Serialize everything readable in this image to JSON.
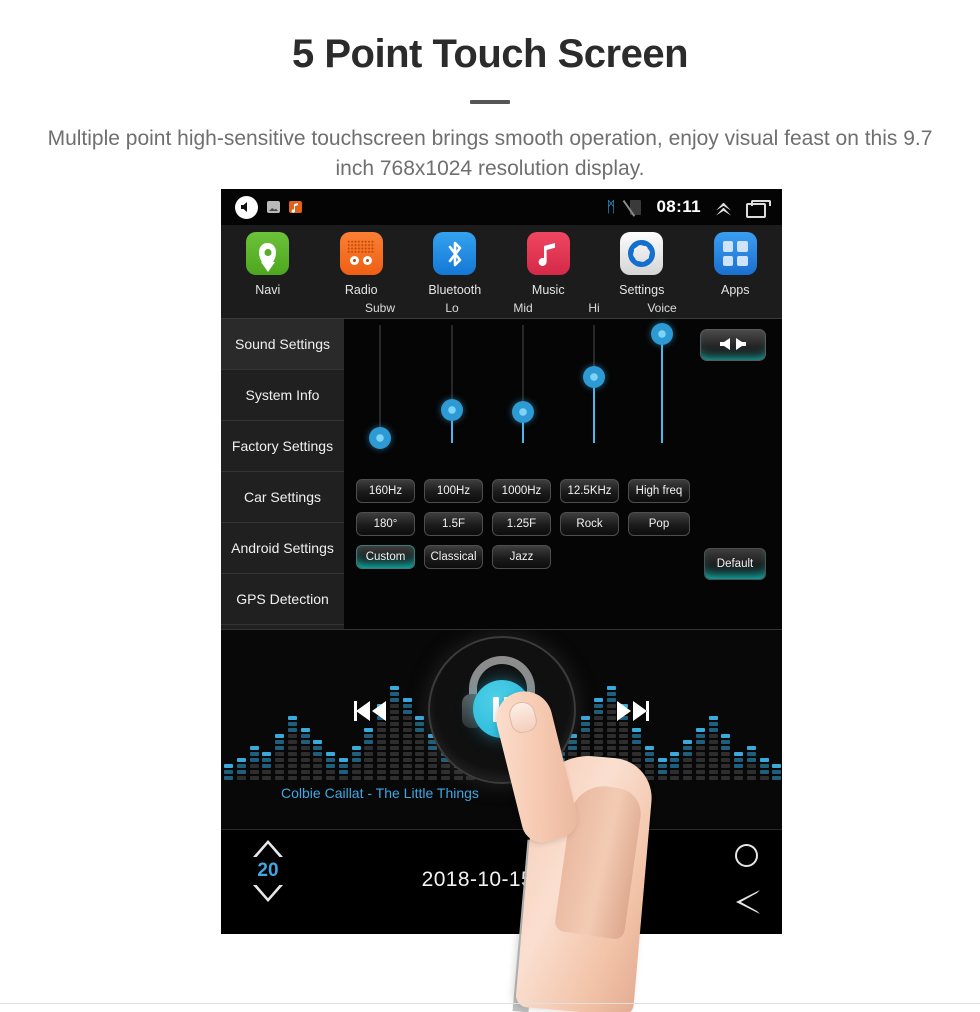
{
  "promo": {
    "title": "5 Point Touch Screen",
    "subtitle": "Multiple point high-sensitive touchscreen brings smooth operation, enjoy visual feast on this 9.7 inch 768x1024 resolution display."
  },
  "statusbar": {
    "speaker_icon": "speaker-icon",
    "image_icon": "image-icon",
    "music_icon": "music-notification-icon",
    "bluetooth_icon": "bluetooth-icon",
    "bluetooth_glyph": "ᛗ",
    "sim_icon": "no-sim-icon",
    "time": "08:11",
    "chevron_icon": "chevron-up-icon",
    "recents_icon": "recent-apps-icon"
  },
  "dock": {
    "items": [
      {
        "label": "Navi",
        "icon": "navi-icon",
        "color": "#57ad28"
      },
      {
        "label": "Radio",
        "icon": "radio-icon",
        "color": "#ef5f13"
      },
      {
        "label": "Bluetooth",
        "icon": "bluetooth-icon",
        "color": "#1478d6"
      },
      {
        "label": "Music",
        "icon": "music-icon",
        "color": "#d42a48"
      },
      {
        "label": "Settings",
        "icon": "settings-icon",
        "color": "#e8e8e8"
      },
      {
        "label": "Apps",
        "icon": "apps-grid-icon",
        "color": "#1a6fd0"
      }
    ]
  },
  "sidebar": {
    "items": [
      {
        "label": "Sound Settings",
        "active": true
      },
      {
        "label": "System Info",
        "active": false
      },
      {
        "label": "Factory Settings",
        "active": false
      },
      {
        "label": "Car Settings",
        "active": false
      },
      {
        "label": "Android Settings",
        "active": false
      },
      {
        "label": "GPS Detection",
        "active": false
      }
    ]
  },
  "equalizer": {
    "sliders": [
      {
        "label": "Subw",
        "value": 4
      },
      {
        "label": "Lo",
        "value": 28
      },
      {
        "label": "Mid",
        "value": 26
      },
      {
        "label": "Hi",
        "value": 56
      },
      {
        "label": "Voice",
        "value": 92
      }
    ],
    "balance_button": {
      "icon": "balance-speakers-icon",
      "left_glyph": "◀",
      "right_glyph": "▶"
    },
    "buttons": [
      [
        {
          "label": "160Hz",
          "active": false
        },
        {
          "label": "100Hz",
          "active": false
        },
        {
          "label": "1000Hz",
          "active": false
        },
        {
          "label": "12.5KHz",
          "active": false
        },
        {
          "label": "High freq",
          "active": false
        }
      ],
      [
        {
          "label": "180°",
          "active": false
        },
        {
          "label": "1.5F",
          "active": false
        },
        {
          "label": "1.25F",
          "active": false
        },
        {
          "label": "Rock",
          "active": false
        },
        {
          "label": "Pop",
          "active": false
        }
      ],
      [
        {
          "label": "Custom",
          "active": true
        },
        {
          "label": "Classical",
          "active": false
        },
        {
          "label": "Jazz",
          "active": false
        }
      ]
    ],
    "default_button": {
      "label": "Default",
      "active": true
    }
  },
  "player": {
    "track_title": "Colbie Caillat - The Little Things",
    "prev_icon": "previous-track-icon",
    "prev_glyph": "◀◀",
    "play_icon": "pause-icon",
    "next_icon": "next-track-icon",
    "next_glyph": "▶▶",
    "headphones_icon": "headphones-icon"
  },
  "bottombar": {
    "volume_up_icon": "volume-up-icon",
    "volume_value": "20",
    "volume_down_icon": "volume-down-icon",
    "datetime": "2018-10-15  Mon",
    "home_icon": "home-icon",
    "back_icon": "back-icon"
  },
  "colors": {
    "accent_blue": "#3fa7e3",
    "accent_teal": "#15d5cf",
    "screen_bg": "#050505"
  }
}
